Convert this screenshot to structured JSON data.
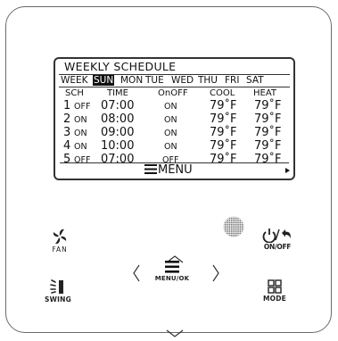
{
  "screen": {
    "title": "WEEKLY SCHEDULE",
    "days": {
      "label": "WEEK",
      "items": [
        "SUN",
        "MON",
        "TUE",
        "WED",
        "THU",
        "FRI",
        "SAT"
      ],
      "selected": "SUN"
    },
    "columns": [
      "SCH",
      "TIME",
      "OnOFF",
      "COOL",
      "HEAT"
    ],
    "rows": [
      {
        "num": "1",
        "sch": "OFF",
        "time": "07:00",
        "onoff": "ON",
        "cool": "79˚F",
        "heat": "79˚F"
      },
      {
        "num": "2",
        "sch": "ON",
        "time": "08:00",
        "onoff": "ON",
        "cool": "79˚F",
        "heat": "79˚F"
      },
      {
        "num": "3",
        "sch": "ON",
        "time": "09:00",
        "onoff": "ON",
        "cool": "79˚F",
        "heat": "79˚F"
      },
      {
        "num": "4",
        "sch": "ON",
        "time": "10:00",
        "onoff": "ON",
        "cool": "79˚F",
        "heat": "79˚F"
      },
      {
        "num": "5",
        "sch": "OFF",
        "time": "07:00",
        "onoff": "OFF",
        "cool": "79˚F",
        "heat": "79˚F"
      }
    ],
    "menu_label": "MENU",
    "menu_icon": "menu-icon",
    "next_icon": "triangle-right-icon"
  },
  "buttons": {
    "fan": {
      "label": "FAN",
      "icon": "fan-icon"
    },
    "swing": {
      "label": "SWING",
      "icon": "swing-icon"
    },
    "menu_ok": {
      "label": "MENU/OK",
      "icon": "menu-icon"
    },
    "power": {
      "label": "ON/OFF",
      "icon": "power-back-icon"
    },
    "mode": {
      "label": "MODE",
      "icon": "grid-icon"
    },
    "up": {
      "icon": "chevron-up-icon"
    },
    "down": {
      "icon": "chevron-down-icon"
    },
    "left": {
      "icon": "chevron-left-icon"
    },
    "right": {
      "icon": "chevron-right-icon"
    },
    "sensor": {
      "icon": "sensor-icon"
    }
  }
}
